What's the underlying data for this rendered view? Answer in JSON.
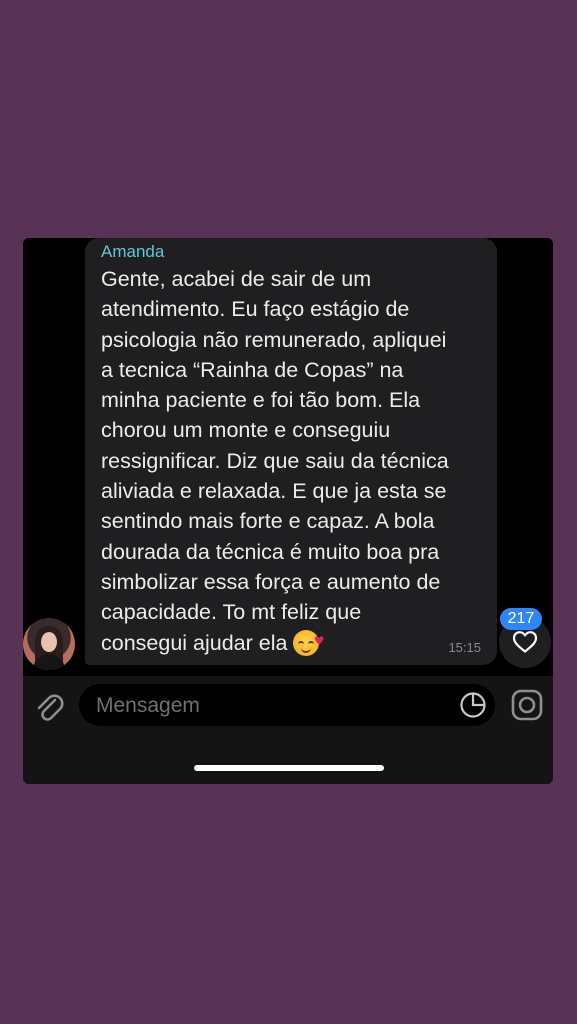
{
  "message": {
    "sender": "Amanda",
    "lines": [
      "Gente, acabei de sair de um",
      "atendimento. Eu faço estágio de",
      "psicologia não remunerado, apliquei",
      "a tecnica “Rainha de Copas” na",
      "minha paciente e foi tão bom. Ela",
      "chorou um monte e conseguiu",
      "ressignificar. Diz que saiu da técnica",
      "aliviada e relaxada. E que ja esta se",
      "sentindo mais forte e capaz. A bola",
      "dourada da técnica é muito boa pra",
      "simbolizar essa força e aumento de",
      "capacidade. To mt feliz que",
      "consegui ajudar ela"
    ],
    "emoji": "smiling-face-with-hearts",
    "time": "15:15"
  },
  "reaction": {
    "count": "217",
    "icon": "heart-icon"
  },
  "composer": {
    "placeholder": "Mensagem",
    "attach_icon": "paperclip-icon",
    "sticker_icon": "sticker-icon",
    "camera_icon": "camera-icon"
  },
  "colors": {
    "page_background": "#583355",
    "bubble": "#1f1f21",
    "sender_name": "#5ec9d4",
    "badge": "#2f86f6"
  }
}
